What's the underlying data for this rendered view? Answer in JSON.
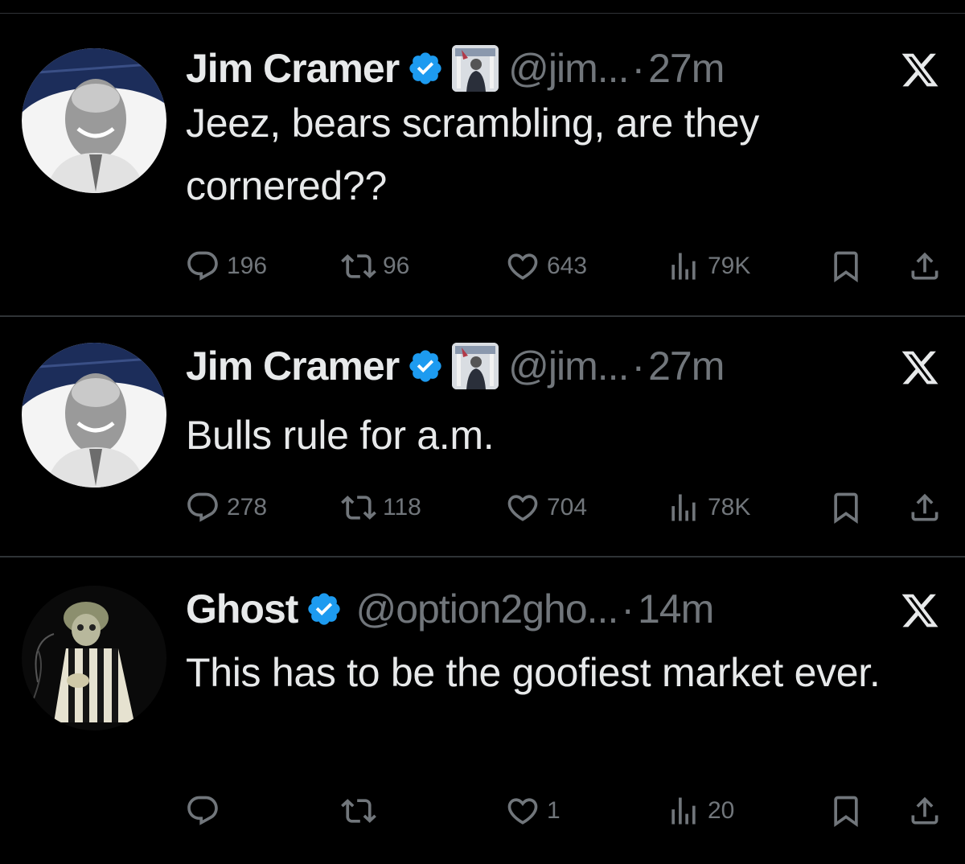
{
  "tweets": [
    {
      "display_name": "Jim Cramer",
      "handle": "@jim...",
      "separator": "·",
      "time": "27m",
      "text": "Jeez, bears scrambling, are they cornered??",
      "avatar_icon": "portrait-photo-icon",
      "replies": "196",
      "reposts": "96",
      "likes": "643",
      "views": "79K"
    },
    {
      "display_name": "Jim Cramer",
      "handle": "@jim...",
      "separator": "·",
      "time": "27m",
      "text": "Bulls rule for a.m.",
      "avatar_icon": "portrait-photo-icon",
      "replies": "278",
      "reposts": "118",
      "likes": "704",
      "views": "78K"
    },
    {
      "display_name": "Ghost",
      "handle": "@option2gho...",
      "separator": "·",
      "time": "14m",
      "text": "This has to be the goofiest market ever.",
      "avatar_icon": "beetlejuice-photo-icon",
      "replies": "",
      "reposts": "",
      "likes": "1",
      "views": "20"
    }
  ],
  "colors": {
    "background": "#000000",
    "primary_text": "#e7e9ea",
    "secondary_text": "#71767b",
    "divider": "#2f3336",
    "verified_blue": "#1d9bf0"
  }
}
